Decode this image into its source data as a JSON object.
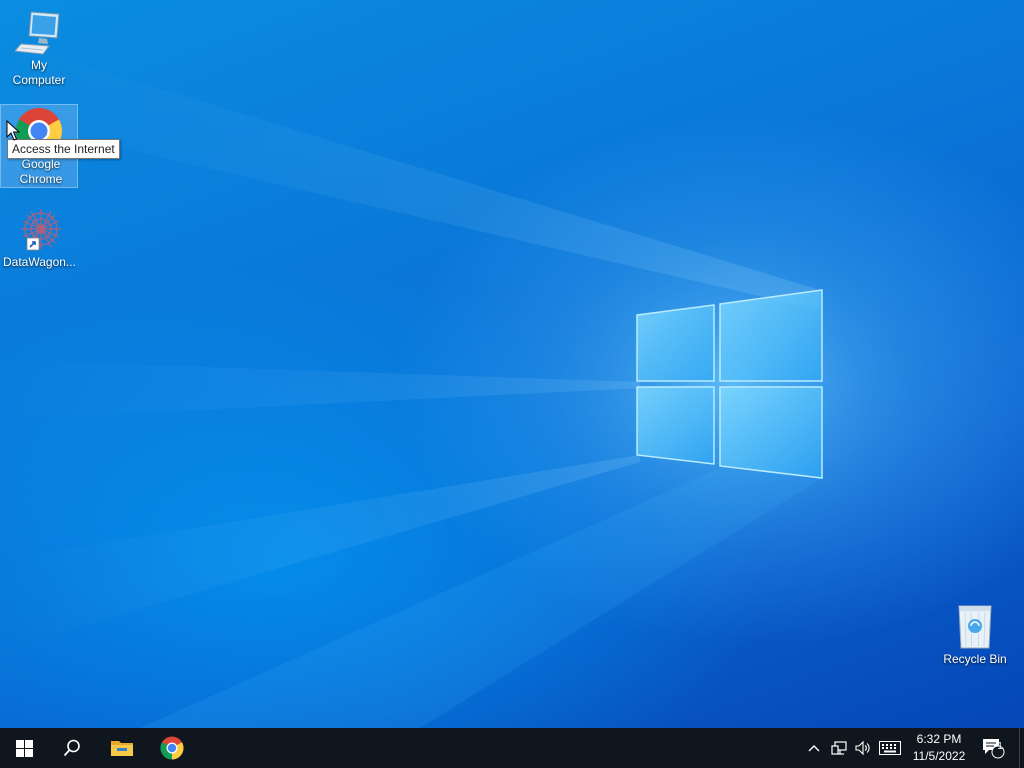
{
  "desktop": {
    "icons": [
      {
        "label": "My Computer"
      },
      {
        "label": "Google Chrome"
      },
      {
        "label": "DataWagon..."
      },
      {
        "label": "Recycle Bin"
      }
    ],
    "tooltip": "Access the Internet"
  },
  "taskbar": {
    "start_icon": "windows-start-icon",
    "search_icon": "search-icon",
    "pinned": [
      "file-explorer-icon",
      "chrome-icon"
    ],
    "tray_icons": [
      "chevron-up-icon",
      "network-icon",
      "volume-icon",
      "keyboard-icon"
    ],
    "clock": {
      "time": "6:32 PM",
      "date": "11/5/2022"
    },
    "notification_count": "1"
  },
  "colors": {
    "taskbar": "#10161d",
    "wallpaper": "#0a76d8",
    "accent": "#4fc3ff"
  }
}
